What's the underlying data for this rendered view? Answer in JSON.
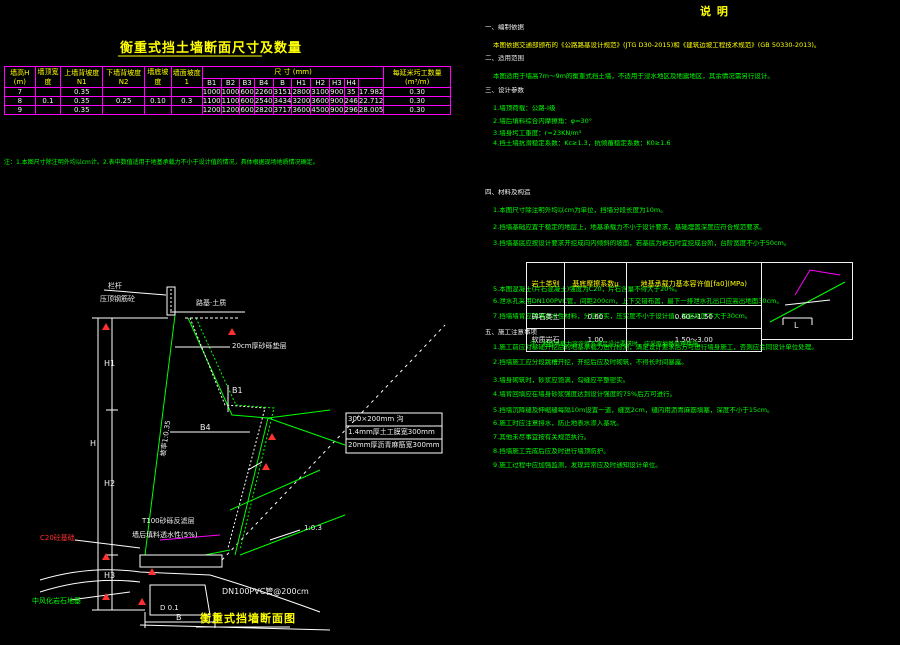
{
  "left_title": "衡重式挡土墙断面尺寸及数量",
  "dim_table": {
    "headers": [
      "墙高H (m)",
      "墙顶宽度",
      "上墙背坡度 N1",
      "下墙背坡度 N2",
      "墙底坡度",
      "墙面坡度 1",
      "尺 寸 (mm)",
      "每延米圬工数量 (m³/m)"
    ],
    "sub_headers": [
      "B1",
      "B2",
      "B3",
      "B4",
      "B",
      "H1",
      "H2",
      "H3",
      "H4"
    ],
    "rows": [
      [
        "7",
        "",
        "0.35",
        "",
        "",
        "",
        "1000",
        "1000",
        "600",
        "2260",
        "3151",
        "2800",
        "3100",
        "900",
        "35",
        "17.982",
        "0.30"
      ],
      [
        "8",
        "0.1",
        "0.35",
        "0.25",
        "0.10",
        "0.3",
        "1100",
        "1100",
        "600",
        "2540",
        "3434",
        "3200",
        "3600",
        "900",
        "246",
        "22.712",
        "0.30"
      ],
      [
        "9",
        "",
        "0.35",
        "",
        "",
        "",
        "1200",
        "1200",
        "600",
        "2820",
        "3717",
        "3600",
        "4500",
        "900",
        "296",
        "28.005",
        "0.30"
      ]
    ]
  },
  "left_note": "注：1.本图尺寸除注明外均以cm计。2.表中数值适用于地基承载力不小于设计值的情况，具体根据现场地质情况确定。",
  "section_title": "衡重式挡墙断面图",
  "section_labels": {
    "railing": "栏杆",
    "top_label": "压顶钢筋砼",
    "road": "路基·土质",
    "drain_top": "20cm厚砂砾垫层",
    "geo1": "300×200mm 沟",
    "geo2": "1.4mm厚土工膜宽300mm",
    "geo3": "20mm厚沥青麻筋宽300mm",
    "pipe": "DN100PVC管@200cm",
    "backfill": "T100砂砾反滤层",
    "slope_note": "墙后填料透水性(5%)",
    "slope": "坡率1:0.35",
    "h": "H",
    "h1": "H1",
    "h2": "H2",
    "h3": "H3",
    "b1": "B1",
    "b4": "B4",
    "b": "B",
    "d": "D 0.1",
    "dim_left1": "C20砼基础",
    "dim_left2": "中风化岩石地基",
    "slope_ratio": "1:0.3"
  },
  "notes_title": "说    明",
  "notes": [
    {
      "text": "一、编制依据",
      "cls": "w"
    },
    {
      "text": "本图依据交通部颁布的《公路路基设计规范》(JTG D30-2015)和《建筑边坡工程技术规范》(GB 50330-2013)。",
      "cls": "y"
    },
    {
      "text": "二、适用范围",
      "cls": "w"
    },
    {
      "text": "本图适用于墙高7m～9m的衡重式挡土墙，不适用于浸水地区及地震地区，其余情况需另行设计。",
      "cls": "g"
    },
    {
      "text": "三、设计参数",
      "cls": "w"
    },
    {
      "text": "1.墙顶荷载：公路-I级",
      "cls": "g"
    },
    {
      "text": "2.墙后填料综合内摩擦角：φ=30°",
      "cls": "g"
    },
    {
      "text": "3.墙身圬工重度：r=23KN/m³",
      "cls": "g"
    },
    {
      "text": "4.挡土墙抗滑稳定系数：Kc≥1.3，抗倾覆稳定系数：K0≥1.6",
      "cls": "g"
    },
    {
      "text": "四、材料及构造",
      "cls": "w"
    },
    {
      "text": "1.本图尺寸除注明外均以cm为单位，挡墙分段长度为10m。",
      "cls": "g"
    },
    {
      "text": "2.挡墙基础应置于稳定的地层上，地基承载力不小于设计要求，基础埋置深度应符合规范要求。",
      "cls": "g"
    },
    {
      "text": "3.挡墙基底应按设计要求开挖成向内倾斜的坡面，若基底为岩石时宜挖成台阶，台阶宽度不小于50cm。",
      "cls": "g"
    },
    {
      "text": "5.本图混凝土(片石混凝土)强度为C20，片石含量不得大于20%。",
      "cls": "g"
    },
    {
      "text": "6.泄水孔采用DN100PVC管，间距200cm，上下交错布置，最下一排泄水孔出口应高出地面30cm。",
      "cls": "g"
    },
    {
      "text": "7.挡墙墙背应回填透水性材料，分层压实，压实度不小于设计值，每层厚度不大于30cm。",
      "cls": "g"
    },
    {
      "text": "五、施工注意事项",
      "cls": "w"
    },
    {
      "text": "1.施工前应对基础开挖后的地基承载力进行检测，满足设计要求后方可进行墙身施工，否则应会同设计单位处理。",
      "cls": "g"
    },
    {
      "text": "2.挡墙施工应分段跳槽开挖，开挖后应及时砌筑，不得长时间暴露。",
      "cls": "g"
    },
    {
      "text": "3.墙身砌筑时，砂浆应饱满，勾缝应平整密实。",
      "cls": "g"
    },
    {
      "text": "4.墙背回填应在墙身砂浆强度达到设计强度的75%后方可进行。",
      "cls": "g"
    },
    {
      "text": "5.挡墙沉降缝及伸缩缝每隔10m设置一道，缝宽2cm，缝内用沥青麻筋填塞，深度不小于15cm。",
      "cls": "g"
    },
    {
      "text": "6.施工时应注意排水，防止地表水渗入基坑。",
      "cls": "g"
    },
    {
      "text": "7.其他未尽事宜按有关规范执行。",
      "cls": "g"
    },
    {
      "text": "8.挡墙施工完成后应及时进行墙顶防护。",
      "cls": "g"
    },
    {
      "text": "9.施工过程中应加强监测，发现异常应及时通知设计单位。",
      "cls": "g"
    }
  ],
  "grout_table": {
    "headers": [
      "岩土类别",
      "基底摩擦系数μ",
      "地基承载力基本容许值[fa0](MPa)"
    ],
    "rows": [
      [
        "碎石类土",
        "0.60",
        "0.60～1.50"
      ],
      [
        "软质岩石",
        "1.00",
        "1.50～3.00"
      ]
    ]
  },
  "grout_note": "注：地基承载力容许值不满足设计要求时，应采取地基处理措施。",
  "diagram_label": "L"
}
